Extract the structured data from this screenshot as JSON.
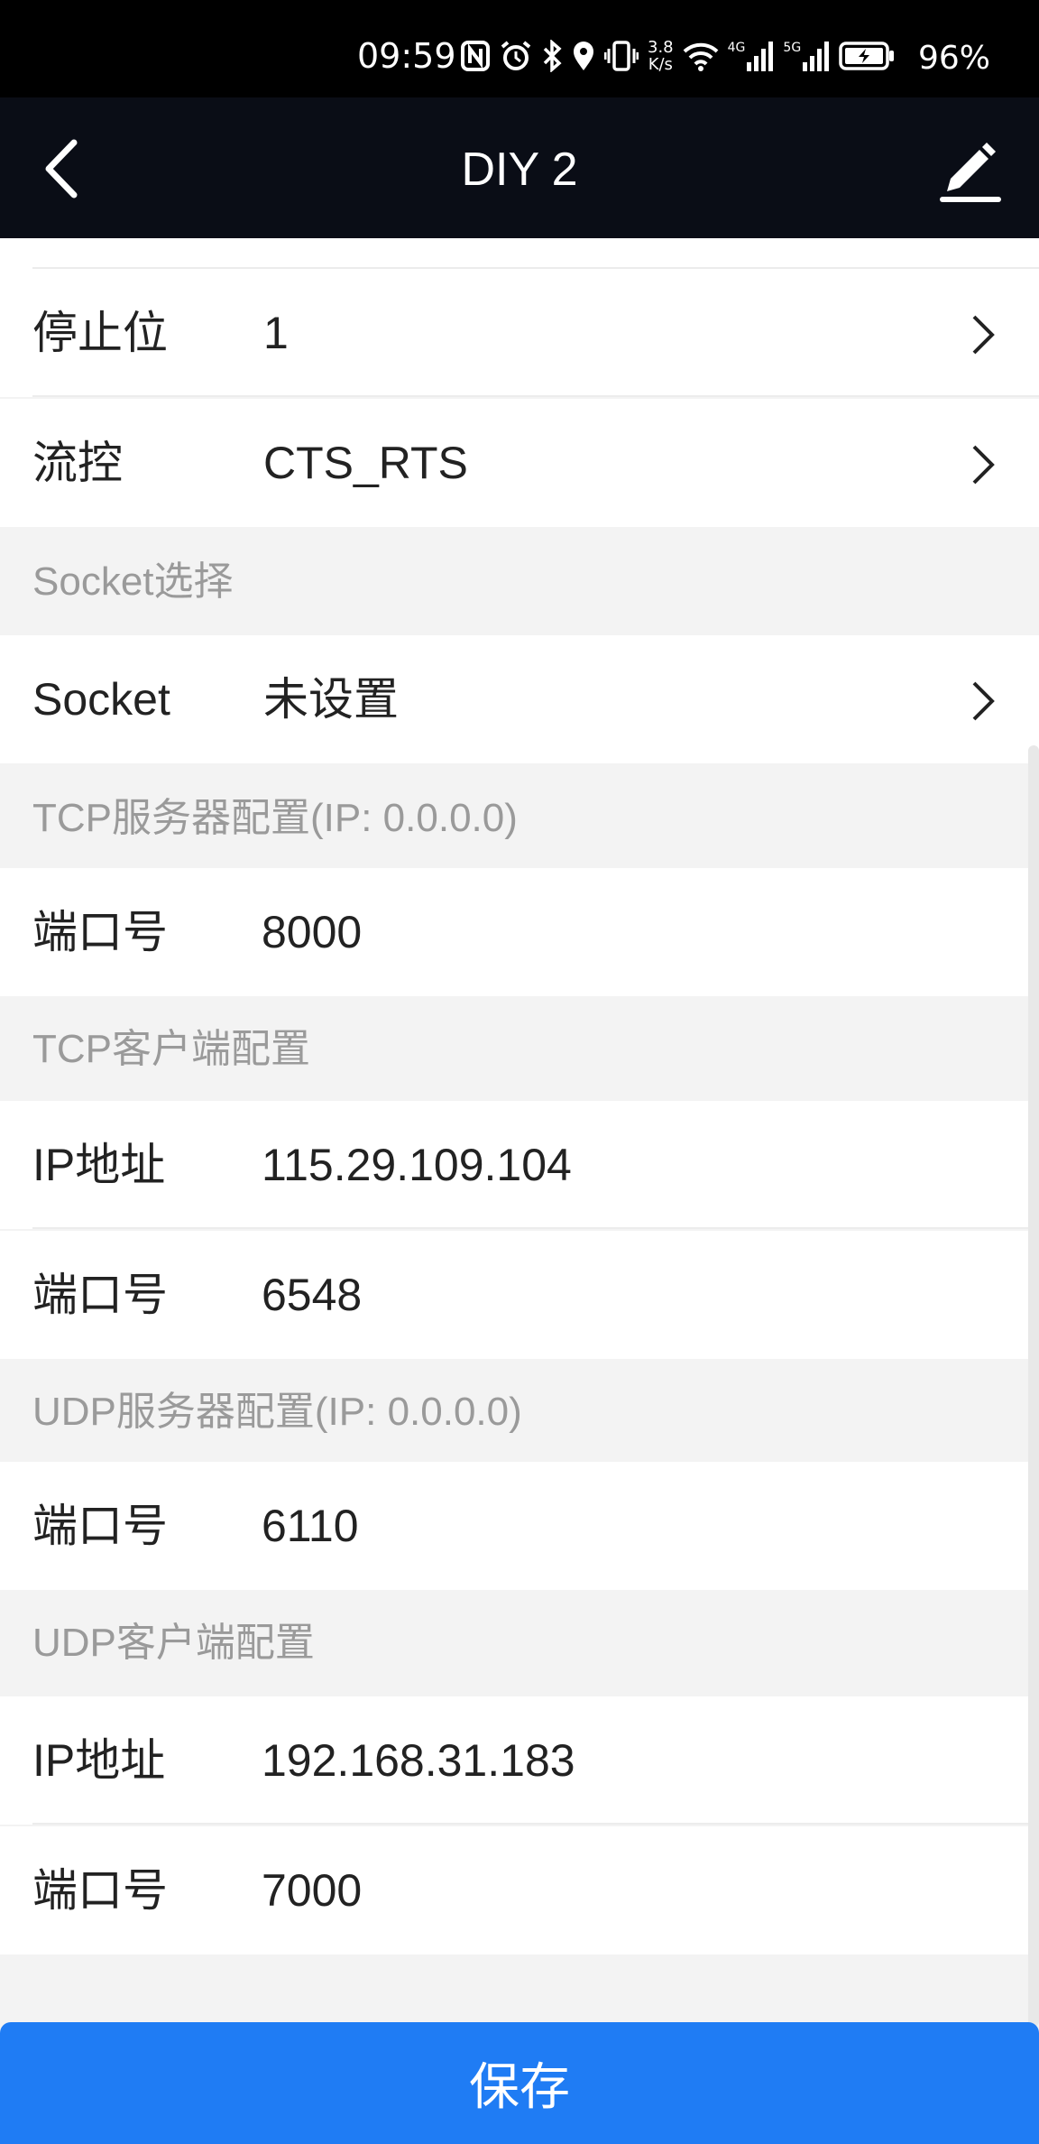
{
  "status_bar": {
    "time": "09:59",
    "net_speed_value": "3.8",
    "net_speed_unit": "K/s",
    "signal1_label": "4G",
    "signal2_label": "5G",
    "battery_percent": "96%",
    "icons": [
      "nfc-icon",
      "alarm-icon",
      "bluetooth-icon",
      "location-icon",
      "vibrate-icon",
      "wifi-icon",
      "signal-icon",
      "signal-icon",
      "battery-charging-icon"
    ]
  },
  "nav": {
    "title": "DIY 2",
    "back_icon": "chevron-left-icon",
    "edit_icon": "pencil-icon"
  },
  "serial": {
    "stop_bits_label": "停止位",
    "stop_bits_value": "1",
    "flow_control_label": "流控",
    "flow_control_value": "CTS_RTS"
  },
  "socket_section": {
    "header": "Socket选择",
    "label": "Socket",
    "value": "未设置"
  },
  "tcp_server": {
    "header": "TCP服务器配置(IP: 0.0.0.0)",
    "port_label": "端口号",
    "port_value": "8000"
  },
  "tcp_client": {
    "header": "TCP客户端配置",
    "ip_label": "IP地址",
    "ip_value": "115.29.109.104",
    "port_label": "端口号",
    "port_value": "6548"
  },
  "udp_server": {
    "header": "UDP服务器配置(IP: 0.0.0.0)",
    "port_label": "端口号",
    "port_value": "6110"
  },
  "udp_client": {
    "header": "UDP客户端配置",
    "ip_label": "IP地址",
    "ip_value": "192.168.31.183",
    "port_label": "端口号",
    "port_value": "7000"
  },
  "save_button": "保存",
  "colors": {
    "primary": "#1f7cf4",
    "nav_bg": "#0a0d16",
    "section_text": "#9a9a9a"
  }
}
